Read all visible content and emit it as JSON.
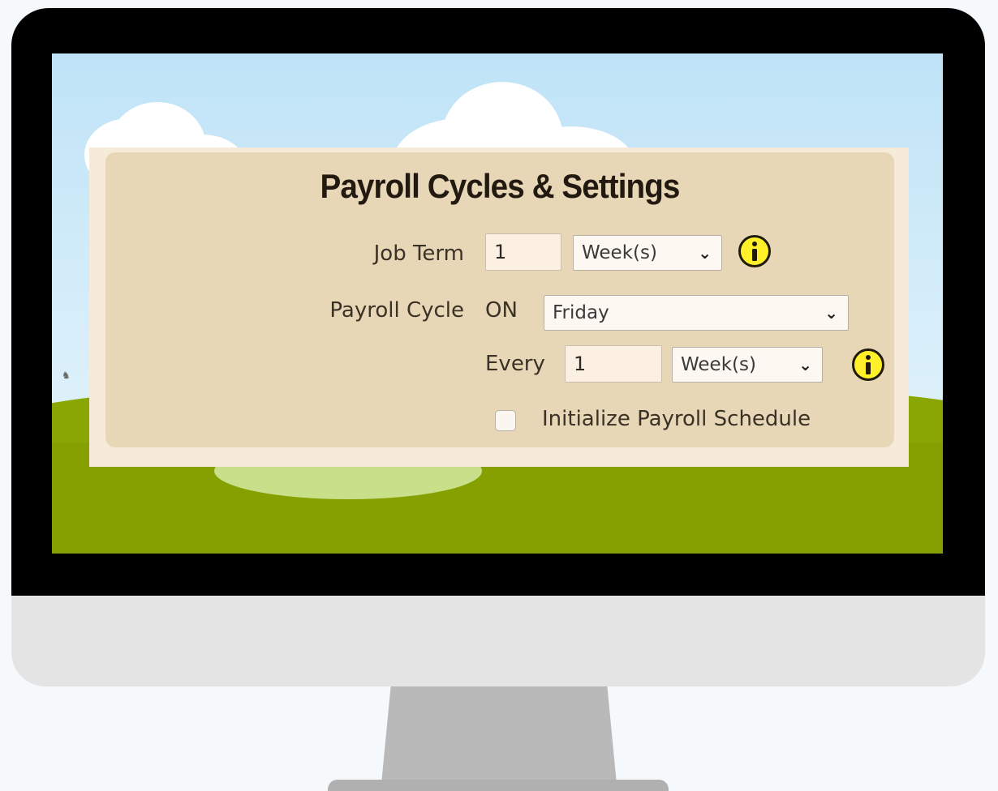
{
  "panel": {
    "title": "Payroll Cycles & Settings",
    "job_term": {
      "label": "Job Term",
      "value": "1",
      "unit_selected": "Week(s)"
    },
    "payroll_cycle": {
      "label": "Payroll Cycle",
      "on_label": "ON",
      "day_selected": "Friday",
      "every_label": "Every",
      "every_value": "1",
      "unit_selected": "Week(s)"
    },
    "initialize": {
      "label": "Initialize Payroll Schedule",
      "checked": false
    }
  },
  "icons": {
    "info": "info-icon",
    "dropdown": "chevron-down-icon",
    "lamb": "lamb-icon"
  },
  "colors": {
    "panel_bg": "#e7d7b7",
    "info_icon": "#fff02a",
    "grass": "#8aa602",
    "sky": "#bfe3f7"
  }
}
